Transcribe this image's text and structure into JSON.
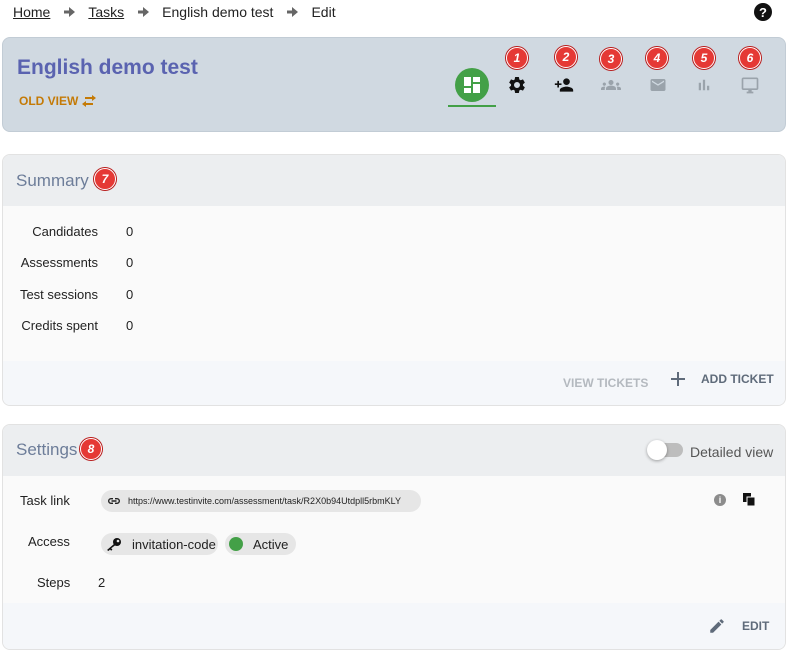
{
  "breadcrumb": {
    "home": "Home",
    "tasks": "Tasks",
    "task": "English demo test",
    "current": "Edit"
  },
  "help": {
    "label": "?"
  },
  "header": {
    "title": "English demo test",
    "old_view": "OLD VIEW",
    "badges": [
      "1",
      "2",
      "3",
      "4",
      "5",
      "6"
    ]
  },
  "summary": {
    "title": "Summary",
    "badge": "7",
    "stats": [
      {
        "label": "Candidates",
        "value": "0"
      },
      {
        "label": "Assessments",
        "value": "0"
      },
      {
        "label": "Test sessions",
        "value": "0"
      },
      {
        "label": "Credits spent",
        "value": "0"
      }
    ],
    "view_tickets": "VIEW TICKETS",
    "add_ticket": "ADD TICKET"
  },
  "settings": {
    "title": "Settings",
    "badge": "8",
    "detailed_view": "Detailed view",
    "task_link_label": "Task link",
    "task_link": "https://www.testinvite.com/assessment/task/R2X0b94Utdpll5rbmKLY",
    "access_label": "Access",
    "access_type": "invitation-code",
    "access_status": "Active",
    "steps_label": "Steps",
    "steps_value": "2",
    "edit": "EDIT"
  },
  "colors": {
    "accent_green": "#43a047",
    "title_blue": "#5a63b0",
    "old_view_orange": "#c47a06",
    "badge_red": "#e53935"
  }
}
